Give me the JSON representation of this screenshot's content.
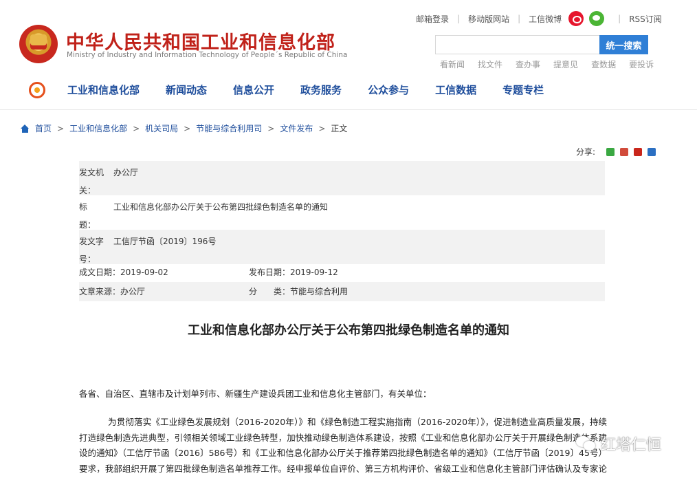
{
  "header": {
    "title": "中华人民共和国工业和信息化部",
    "subtitle": "Ministry of Industry and Information Technology of People´s Republic of China",
    "top_links": {
      "mail_login": "邮箱登录",
      "mobile_site": "移动版网站",
      "weibo": "工信微博",
      "rss": "RSS订阅"
    },
    "search": {
      "placeholder": "",
      "button": "统一搜索"
    },
    "quick_links": [
      "看新闻",
      "找文件",
      "查办事",
      "提意见",
      "查数据",
      "要投诉"
    ],
    "nav": [
      "工业和信息化部",
      "新闻动态",
      "信息公开",
      "政务服务",
      "公众参与",
      "工信数据",
      "专题专栏"
    ]
  },
  "breadcrumb": {
    "items": [
      "首页",
      "工业和信息化部",
      "机关司局",
      "节能与综合利用司",
      "文件发布"
    ],
    "current": "正文",
    "separator": ">"
  },
  "share": {
    "label": "分享:"
  },
  "meta": {
    "issuer_label": "发文机关：",
    "issuer": "办公厅",
    "title_label": "标　　题：",
    "title": "工业和信息化部办公厅关于公布第四批绿色制造名单的通知",
    "docno_label": "发文字号：",
    "docno": "工信厅节函〔2019〕196号",
    "written_date": "成文日期：2019-09-02",
    "published_date": "发布日期：2019-09-12",
    "source": "文章来源：办公厅",
    "category": "分　　类：节能与综合利用"
  },
  "article": {
    "title": "工业和信息化部办公厅关于公布第四批绿色制造名单的通知",
    "salutation": "各省、自治区、直辖市及计划单列市、新疆生产建设兵团工业和信息化主管部门，有关单位：",
    "paragraph": "为贯彻落实《工业绿色发展规划（2016-2020年）》和《绿色制造工程实施指南（2016-2020年）》，促进制造业高质量发展，持续打造绿色制造先进典型，引领相关领域工业绿色转型，加快推动绿色制造体系建设，按照《工业和信息化部办公厅关于开展绿色制造体系建设的通知》（工信厅节函〔2016〕586号）和《工业和信息化部办公厅关于推荐第四批绿色制造名单的通知》（工信厅节函〔2019〕45号）要求，我部组织开展了第四批绿色制造名单推荐工作。经申报单位自评价、第三方机构评价、省级工业和信息化主管部门评估确认及专家论证、公示等环节，确定"
  },
  "watermark": {
    "text": "红塔仁恒"
  },
  "colors": {
    "brand_red": "#c0221a",
    "nav_blue": "#1f4e9c",
    "search_blue": "#2f7fd6"
  }
}
